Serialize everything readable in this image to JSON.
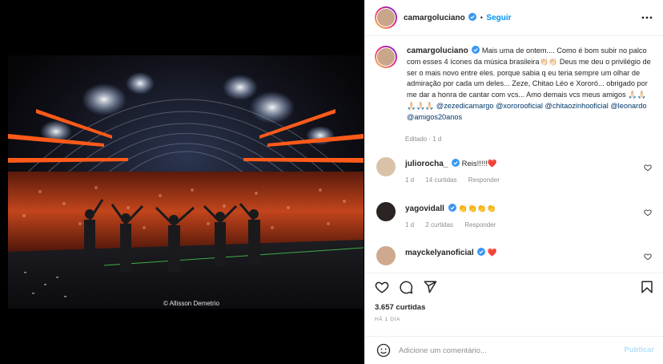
{
  "post": {
    "username": "camargoluciano",
    "follow_label": "Seguir",
    "photo_credit": "© Allisson Demetrio"
  },
  "caption": {
    "username": "camargoluciano",
    "text_1": "Mais uma de ontem.... Como é bom subir no palco com esses 4 ícones da música brasileira👏🏻👏🏻 Deus me deu o privilégio de ser o mais novo entre eles. porque sabia q eu teria sempre um olhar de admiração por cada um deles... Zeze, Chitao Léo e Xororó... obrigado por me dar a honra de cantar com vcs... Amo demais vcs meus amigos 🙏🏻🙏🏻🙏🏻🙏🏻🙏🏻 ",
    "tags": [
      "@zezedicamargo",
      "@xororooficial",
      "@chitaozinhooficial",
      "@leonardo",
      "@amigos20anos"
    ],
    "edited_label": "Editado · 1 d"
  },
  "comments": [
    {
      "username": "juliorocha_",
      "text": "Reis!!!!!❤️",
      "time": "1 d",
      "likes": "14 curtidas",
      "reply": "Responder"
    },
    {
      "username": "yagovidall",
      "text": "👏👏👏👏",
      "time": "1 d",
      "likes": "2 curtidas",
      "reply": "Responder"
    },
    {
      "username": "mayckelyanoficial",
      "text": "❤️"
    }
  ],
  "actions": {
    "likes_count": "3.657 curtidas",
    "time_ago": "HÁ 1 DIA"
  },
  "composer": {
    "placeholder": "Adicione um comentário...",
    "publish_label": "Publicar"
  },
  "colors": {
    "accent": "#0095f6",
    "verified": "#3897f0",
    "heart": "#ed4956",
    "stage_orange": "#ff5a1a"
  },
  "icons": [
    "more-options-icon",
    "verified-badge-icon",
    "heart-icon",
    "comment-icon",
    "share-icon",
    "bookmark-icon",
    "emoji-icon"
  ]
}
